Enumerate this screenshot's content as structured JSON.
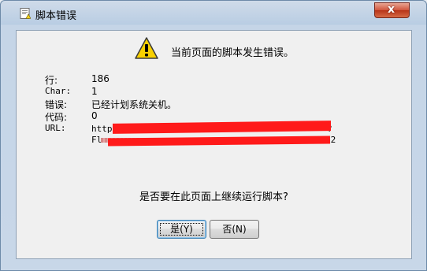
{
  "window": {
    "title": "脚本错误",
    "close_label": "x"
  },
  "dialog": {
    "heading": "当前页面的脚本发生错误。",
    "fields": {
      "line_label": "行:",
      "line_value": "186",
      "char_label": "Char:",
      "char_value": "1",
      "error_label": "错误:",
      "error_value": "已经计划系统关机。",
      "code_label": "代码:",
      "code_value": "0",
      "url_label": "URL:",
      "url_line1_start": "http:",
      "url_line1_end": "?",
      "url_line2_start": "Fl",
      "url_line2_end": "12"
    },
    "question": "是否要在此页面上继续运行脚本?",
    "buttons": {
      "yes": "是(Y)",
      "no": "否(N)"
    }
  },
  "icons": {
    "title": "script-error-icon",
    "warning": "warning-icon",
    "close": "close-icon"
  }
}
